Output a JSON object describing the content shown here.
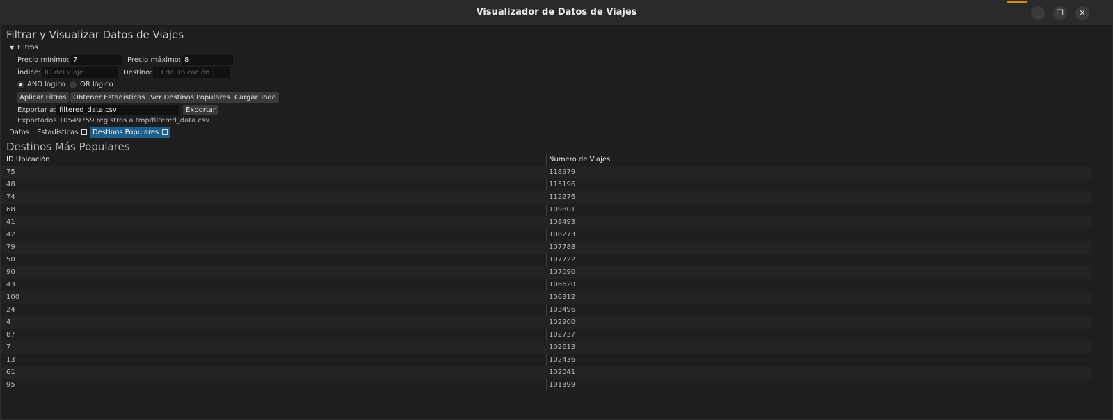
{
  "window": {
    "title": "Visualizador de Datos de Viajes",
    "controls": {
      "minimize": "_",
      "maximize": "❐",
      "close": "✕"
    }
  },
  "heading": "Filtrar y Visualizar Datos de Viajes",
  "filters": {
    "section_label": "Filtros",
    "precio_min_label": "Precio mínimo:",
    "precio_min_value": "7",
    "precio_max_label": "Precio máximo:",
    "precio_max_value": "8",
    "indice_label": "Índice:",
    "indice_placeholder": "ID del viaje",
    "destino_label": "Destino:",
    "destino_placeholder": "ID de ubicación",
    "logic_and": "AND lógico",
    "logic_or": "OR lógico",
    "logic_selected": "AND",
    "buttons": {
      "apply": "Aplicar Filtros",
      "stats": "Obtener Estadísticas",
      "popular": "Ver Destinos Populares",
      "load_all": "Cargar Todo"
    },
    "export_label": "Exportar a:",
    "export_value": "filtered_data.csv",
    "export_button": "Exportar",
    "status": "Exportados 10549759 registros a tmp/filtered_data.csv"
  },
  "tabs": {
    "datos": "Datos",
    "estadisticas": "Estadísticas",
    "destinos": "Destinos Populares",
    "active": "destinos"
  },
  "section_title": "Destinos Más Populares",
  "table": {
    "columns": [
      "ID Ubicación",
      "Número de Viajes"
    ],
    "rows": [
      [
        "75",
        "118979"
      ],
      [
        "48",
        "115196"
      ],
      [
        "74",
        "112276"
      ],
      [
        "68",
        "109801"
      ],
      [
        "41",
        "108493"
      ],
      [
        "42",
        "108273"
      ],
      [
        "79",
        "107788"
      ],
      [
        "50",
        "107722"
      ],
      [
        "90",
        "107090"
      ],
      [
        "43",
        "106620"
      ],
      [
        "100",
        "106312"
      ],
      [
        "24",
        "103496"
      ],
      [
        "4",
        "102900"
      ],
      [
        "87",
        "102737"
      ],
      [
        "7",
        "102613"
      ],
      [
        "13",
        "102436"
      ],
      [
        "61",
        "102041"
      ],
      [
        "95",
        "101399"
      ]
    ]
  },
  "colors": {
    "active_tab": "#1f5f8b",
    "window_bg": "#1e1e1e",
    "titlebar_bg": "#2a2a2a"
  }
}
